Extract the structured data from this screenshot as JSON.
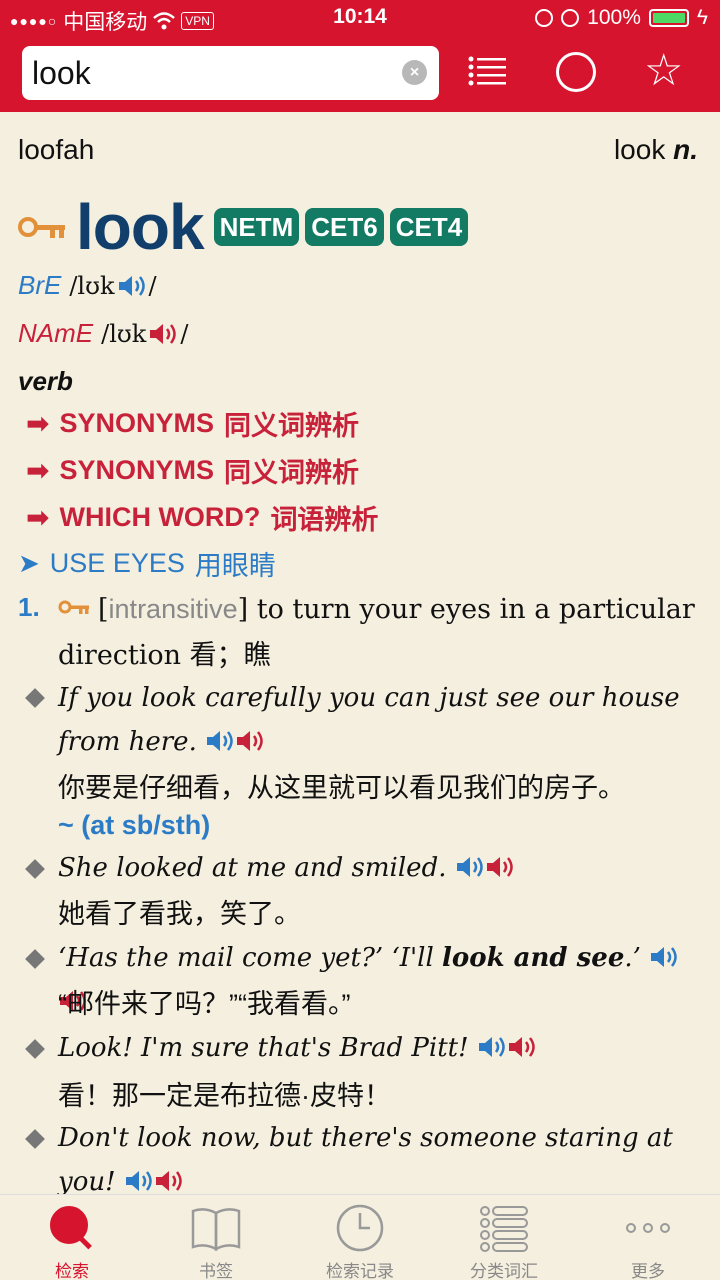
{
  "status_bar": {
    "carrier": "中国移动",
    "vpn": "VPN",
    "time": "10:14",
    "battery": "100%",
    "battery_level": 1.0
  },
  "search": {
    "value": "look",
    "clear_icon": "clear-circle-icon",
    "list_icon": "list-icon",
    "circle_icon": "circle-icon",
    "star_icon": "star-icon"
  },
  "nav": {
    "prev_word": "loofah",
    "next_word": "look",
    "next_pos": "n."
  },
  "entry": {
    "headword": "look",
    "badges": [
      "NETM",
      "CET6",
      "CET4"
    ],
    "bre_label": "BrE",
    "bre_ipa": "/lʊk",
    "name_label": "NAmE",
    "name_ipa": "/lʊk",
    "slash": "/",
    "pos": "verb",
    "xrefs": [
      {
        "en": "SYNONYMS",
        "zh": "同义词辨析"
      },
      {
        "en": "SYNONYMS",
        "zh": "同义词辨析"
      },
      {
        "en": "WHICH WORD?",
        "zh": "词语辨析"
      }
    ],
    "shortcut_en": "USE EYES",
    "shortcut_zh": "用眼睛",
    "sense_number": "1.",
    "sense_grammar_open": "[",
    "sense_grammar": "intransitive",
    "sense_grammar_close": "]",
    "sense_definition": " to turn your eyes in a particular direction ",
    "sense_translation": "看；瞧",
    "examples": [
      {
        "en": "If you look carefully you can just see our house from here.",
        "zh": "你要是仔细看，从这里就可以看见我们的房子。"
      },
      {
        "en": "She looked at me and smiled.",
        "zh": "她看了看我，笑了。"
      },
      {
        "en_pre": "‘Has the mail come yet?’ ‘I'll ",
        "en_bold": "look and see",
        "en_post": ".’",
        "zh": "“邮件来了吗？”“我看看。”"
      },
      {
        "en": "Look! I'm sure that's Brad Pitt!",
        "zh": "看！那一定是布拉德·皮特！"
      },
      {
        "en": "Don't look now, but there's someone staring at you!"
      }
    ],
    "pattern": "~ (at sb/sth)"
  },
  "tabs": [
    {
      "label": "检索",
      "icon": "search-icon",
      "active": true
    },
    {
      "label": "书签",
      "icon": "book-icon",
      "active": false
    },
    {
      "label": "检索记录",
      "icon": "clock-icon",
      "active": false
    },
    {
      "label": "分类词汇",
      "icon": "list-icon",
      "active": false
    },
    {
      "label": "更多",
      "icon": "more-icon",
      "active": false
    }
  ],
  "colors": {
    "header_red": "#d7142e",
    "headword_navy": "#123e6b",
    "badge_green": "#137a63",
    "link_blue": "#2b7bc6",
    "xref_red": "#c8213a",
    "background": "#f4efdf"
  }
}
